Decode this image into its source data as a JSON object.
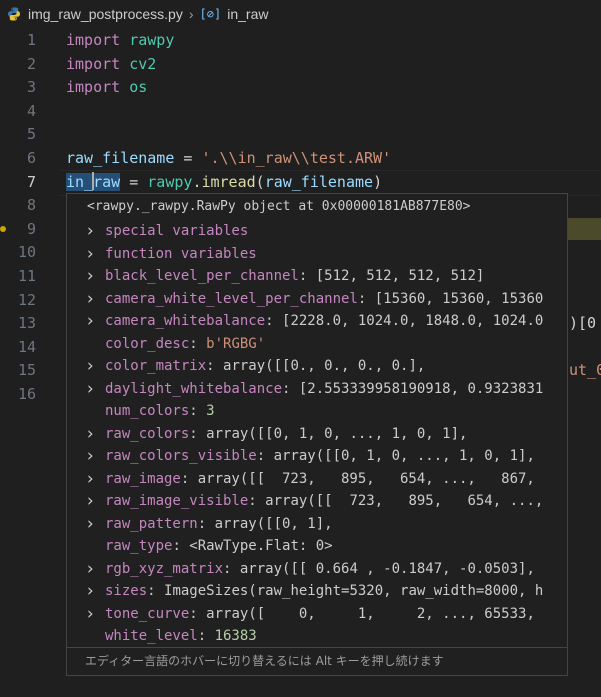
{
  "breadcrumb": {
    "file": "img_raw_postprocess.py",
    "separator": "›",
    "symbol": "in_raw"
  },
  "editor": {
    "lines": [
      {
        "num": "1",
        "tokens": [
          [
            "kw",
            "import"
          ],
          [
            "op",
            " "
          ],
          [
            "mod",
            "rawpy"
          ]
        ]
      },
      {
        "num": "2",
        "tokens": [
          [
            "kw",
            "import"
          ],
          [
            "op",
            " "
          ],
          [
            "mod",
            "cv2"
          ]
        ]
      },
      {
        "num": "3",
        "tokens": [
          [
            "kw",
            "import"
          ],
          [
            "op",
            " "
          ],
          [
            "mod",
            "os"
          ]
        ]
      },
      {
        "num": "4",
        "tokens": []
      },
      {
        "num": "5",
        "tokens": []
      },
      {
        "num": "6",
        "tokens": [
          [
            "var",
            "raw_filename"
          ],
          [
            "op",
            " = "
          ],
          [
            "str",
            "'.\\\\in_raw\\\\test.ARW'"
          ]
        ]
      },
      {
        "num": "7",
        "tokens": [
          [
            "var",
            "in_raw"
          ],
          [
            "op",
            " = "
          ],
          [
            "mod",
            "rawpy"
          ],
          [
            "op",
            "."
          ],
          [
            "fn",
            "imread"
          ],
          [
            "op",
            "("
          ],
          [
            "var",
            "raw_filename"
          ],
          [
            "op",
            ")"
          ]
        ]
      },
      {
        "num": "8",
        "tokens": []
      },
      {
        "num": "9",
        "tokens": []
      },
      {
        "num": "10",
        "tokens": []
      },
      {
        "num": "11",
        "tokens": []
      },
      {
        "num": "12",
        "tokens": []
      },
      {
        "num": "13",
        "tokens": []
      },
      {
        "num": "14",
        "tokens": []
      },
      {
        "num": "15",
        "tokens": []
      },
      {
        "num": "16",
        "tokens": []
      }
    ],
    "partial_right_line13": ")[0",
    "partial_right_line15": "ut_0"
  },
  "hover": {
    "title": "<rawpy._rawpy.RawPy object at 0x00000181AB877E80>",
    "rows": [
      {
        "chevron": true,
        "key": "special variables",
        "val": ""
      },
      {
        "chevron": true,
        "key": "function variables",
        "val": ""
      },
      {
        "chevron": true,
        "key": "black_level_per_channel",
        "val": ": [512, 512, 512, 512]"
      },
      {
        "chevron": true,
        "key": "camera_white_level_per_channel",
        "val": ": [15360, 15360, 15360"
      },
      {
        "chevron": true,
        "key": "camera_whitebalance",
        "val": ": [2228.0, 1024.0, 1848.0, 1024.0"
      },
      {
        "chevron": false,
        "key": "color_desc",
        "val": ": b'RGBG'"
      },
      {
        "chevron": true,
        "key": "color_matrix",
        "val": ": array([[0., 0., 0., 0.],"
      },
      {
        "chevron": true,
        "key": "daylight_whitebalance",
        "val": ": [2.553339958190918, 0.9323831"
      },
      {
        "chevron": false,
        "key": "num_colors",
        "val": ": 3"
      },
      {
        "chevron": true,
        "key": "raw_colors",
        "val": ": array([[0, 1, 0, ..., 1, 0, 1],"
      },
      {
        "chevron": true,
        "key": "raw_colors_visible",
        "val": ": array([[0, 1, 0, ..., 1, 0, 1],"
      },
      {
        "chevron": true,
        "key": "raw_image",
        "val": ": array([[  723,   895,   654, ...,   867,"
      },
      {
        "chevron": true,
        "key": "raw_image_visible",
        "val": ": array([[  723,   895,   654, ...,"
      },
      {
        "chevron": true,
        "key": "raw_pattern",
        "val": ": array([[0, 1],"
      },
      {
        "chevron": false,
        "key": "raw_type",
        "val": ": <RawType.Flat: 0>"
      },
      {
        "chevron": true,
        "key": "rgb_xyz_matrix",
        "val": ": array([[ 0.664 , -0.1847, -0.0503],"
      },
      {
        "chevron": true,
        "key": "sizes",
        "val": ": ImageSizes(raw_height=5320, raw_width=8000, h"
      },
      {
        "chevron": true,
        "key": "tone_curve",
        "val": ": array([    0,     1,     2, ..., 65533,"
      },
      {
        "chevron": false,
        "key": "white_level",
        "val": ": 16383"
      }
    ],
    "footer": "エディター言語のホバーに切り替えるには Alt キーを押し続けます"
  },
  "colors": {
    "background": "#1f1f1f",
    "keyword": "#c586c0",
    "module": "#4ec9b0",
    "variable": "#9cdcfe",
    "function": "#dcdcaa",
    "string": "#ce9178",
    "number": "#b5cea8"
  }
}
